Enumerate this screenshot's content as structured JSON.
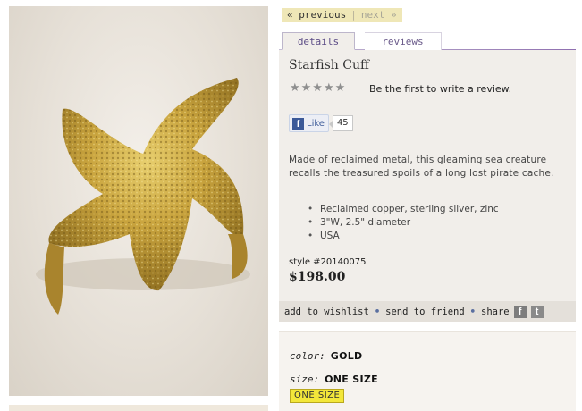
{
  "pager": {
    "previous": "« previous",
    "separator": "|",
    "next": "next »"
  },
  "tabs": [
    {
      "label": "details"
    },
    {
      "label": "reviews"
    }
  ],
  "product": {
    "title": "Starfish Cuff",
    "rating_stars": "★★★★★",
    "review_prompt": "Be the first to write a review.",
    "facebook": {
      "like_label": "Like",
      "like_count": "45"
    },
    "description": "Made of reclaimed metal, this gleaming sea creature recalls the treasured spoils of a long lost pirate cache.",
    "features": [
      "Reclaimed copper, sterling silver, zinc",
      "3\"W, 2.5\" diameter",
      "USA"
    ],
    "style_number": "style #20140075",
    "price": "$198.00"
  },
  "actions": {
    "wishlist": "add to wishlist",
    "send": "send to friend",
    "share": "share",
    "dot": "•"
  },
  "options": {
    "color_label": "color:",
    "color_value": "GOLD",
    "size_label": "size:",
    "size_value": "ONE SIZE",
    "size_choices": [
      "ONE SIZE"
    ]
  },
  "icons": {
    "facebook_logo": "facebook-f-icon",
    "share_facebook": "facebook-icon",
    "share_twitter": "twitter-icon",
    "star": "star-icon"
  },
  "colors": {
    "pager_bg": "#efe7b7",
    "panel_bg": "#f1eeea",
    "facebook_blue": "#3b5998",
    "size_chip": "#f3e73a"
  }
}
